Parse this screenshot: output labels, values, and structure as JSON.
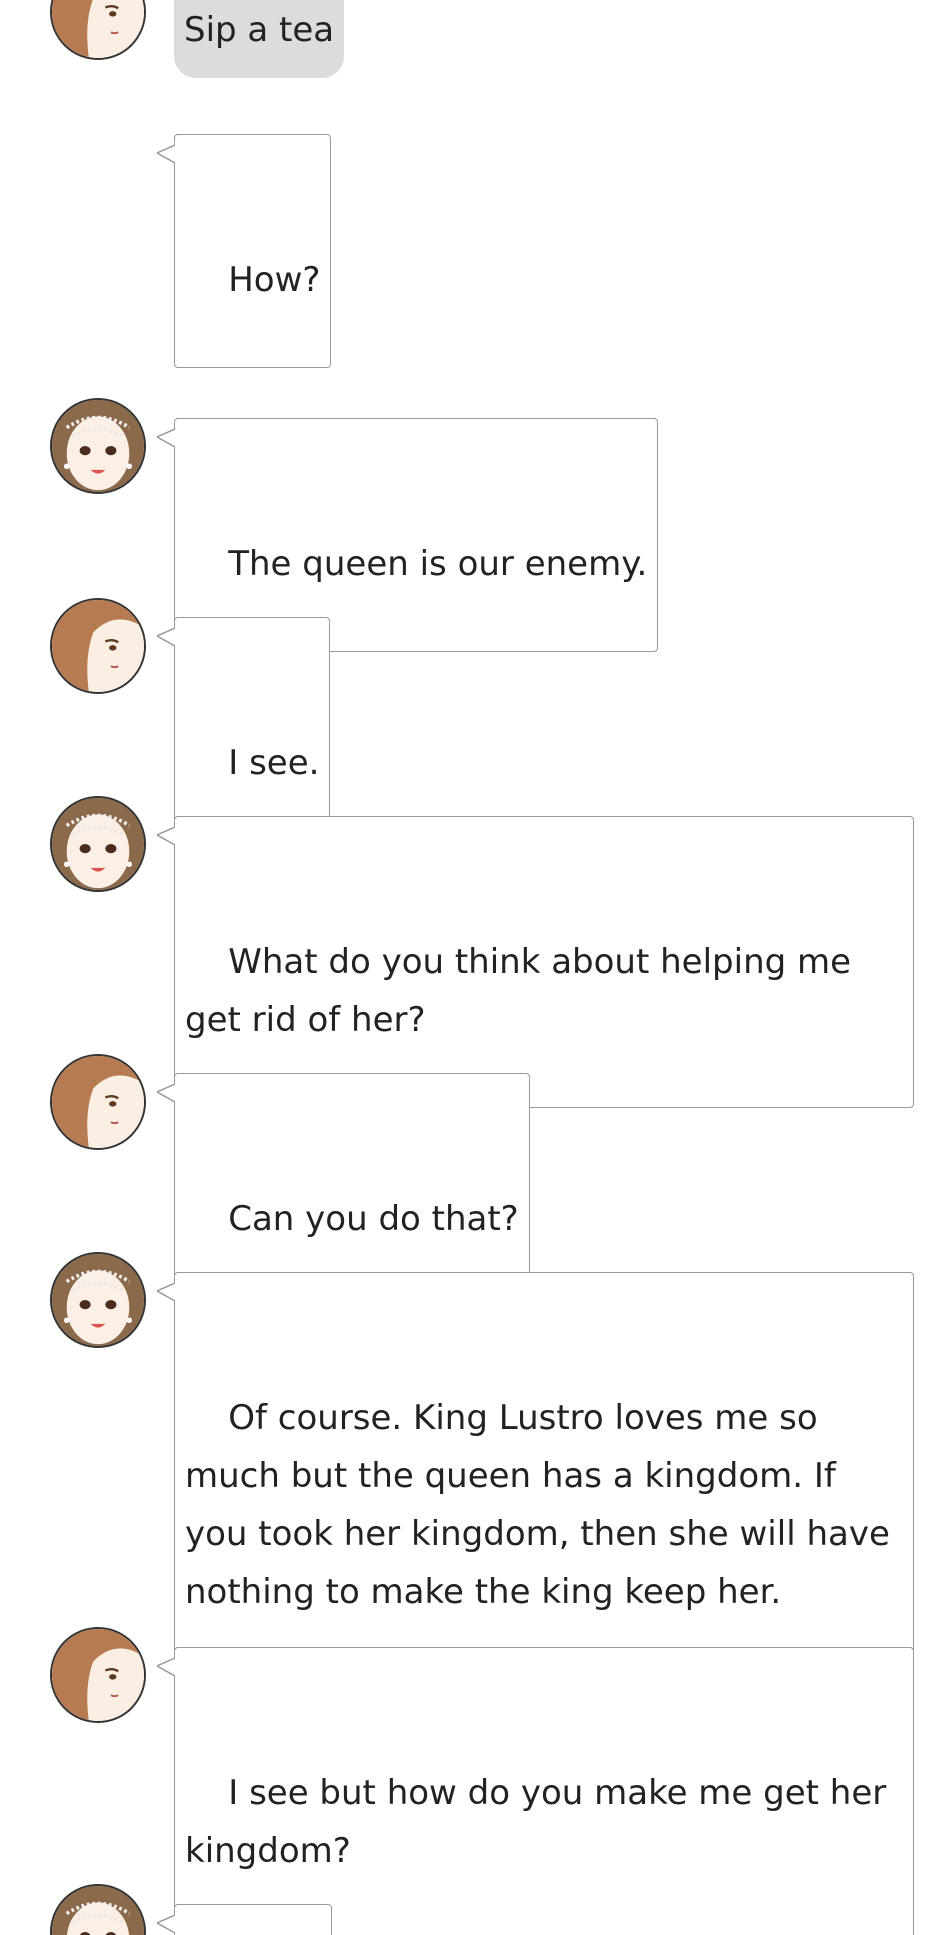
{
  "choice": {
    "label": "Sip a tea"
  },
  "messages": [
    {
      "speaker": "player",
      "text": "How?"
    },
    {
      "speaker": "rival",
      "text": "The queen is our enemy."
    },
    {
      "speaker": "player",
      "text": "I see."
    },
    {
      "speaker": "rival",
      "text": "What do you think about helping me get rid of her?"
    },
    {
      "speaker": "player",
      "text": "Can you do that?"
    },
    {
      "speaker": "rival",
      "text": "Of course. King Lustro loves me so much but the queen has a kingdom. If you took her kingdom, then she will have nothing to make the king keep her."
    },
    {
      "speaker": "player",
      "text": "I see but how do you make me get her kingdom?"
    },
    {
      "speaker": "rival",
      "text": ""
    }
  ],
  "avatars": {
    "player": {
      "icon": "brown-haired-girl-avatar",
      "hair": "#b77b52",
      "skin": "#fbeee3"
    },
    "rival": {
      "icon": "pearl-tiara-lady-avatar",
      "hair": "#8a6a4b",
      "skin": "#fbefe6"
    }
  },
  "colors": {
    "bubble_border": "#9a9a9a",
    "choice_bg": "#dcdcdc",
    "text": "#222222"
  }
}
